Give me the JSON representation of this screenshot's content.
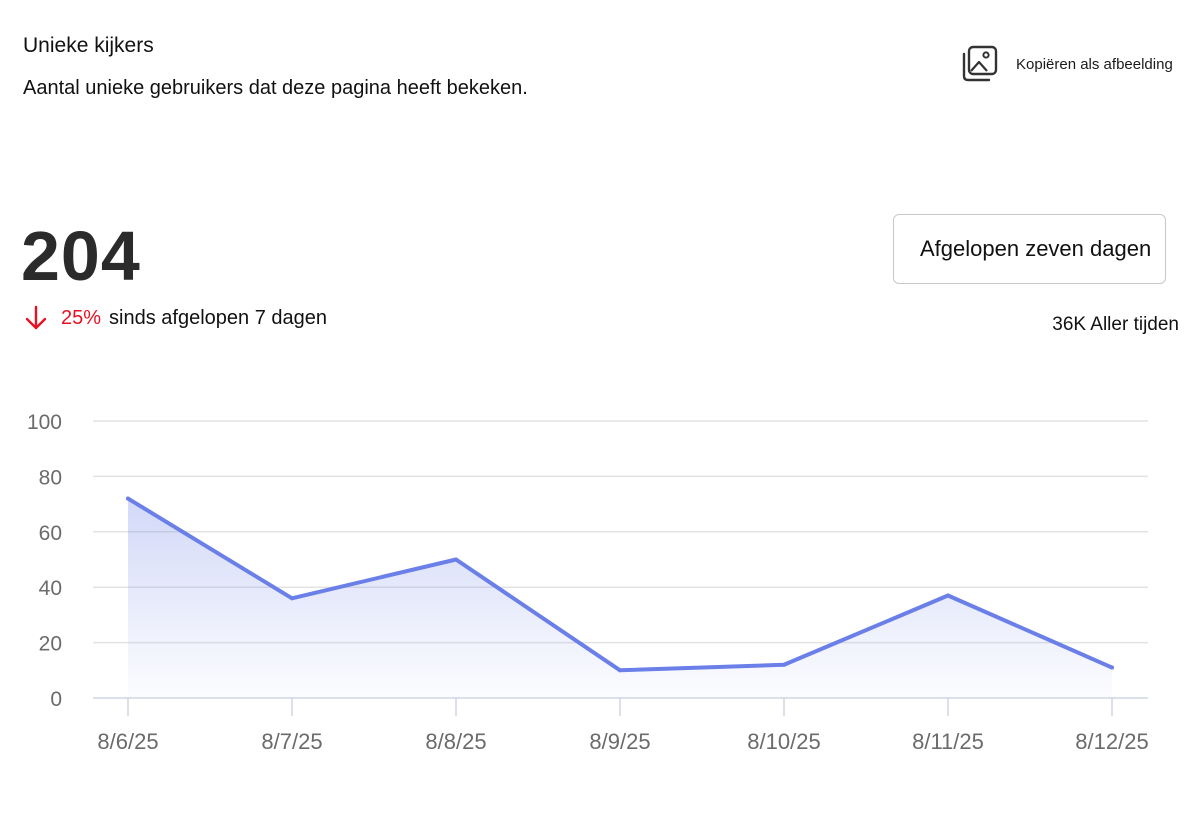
{
  "header": {
    "title": "Unieke kijkers",
    "subtitle": "Aantal unieke gebruikers dat deze pagina heeft bekeken.",
    "copy_label": "Kopiëren als afbeelding",
    "copy_icon": "image-icon"
  },
  "summary": {
    "value": "204",
    "change_pct": "25%",
    "change_direction": "down",
    "change_text": "sinds afgelopen 7 dagen",
    "all_time": "36K Aller tijden"
  },
  "range_select": {
    "value": "Afgelopen zeven dagen"
  },
  "colors": {
    "line": "#6b7fe8",
    "down": "#e81123",
    "grid": "#e3e3e3"
  },
  "chart_data": {
    "type": "area",
    "x": [
      "8/6/25",
      "8/7/25",
      "8/8/25",
      "8/9/25",
      "8/10/25",
      "8/11/25",
      "8/12/25"
    ],
    "series": [
      {
        "values": [
          72,
          36,
          50,
          10,
          12,
          37,
          11
        ]
      }
    ],
    "yticks": [
      0,
      20,
      40,
      60,
      80,
      100
    ],
    "ylim": [
      0,
      100
    ],
    "grid": true
  }
}
